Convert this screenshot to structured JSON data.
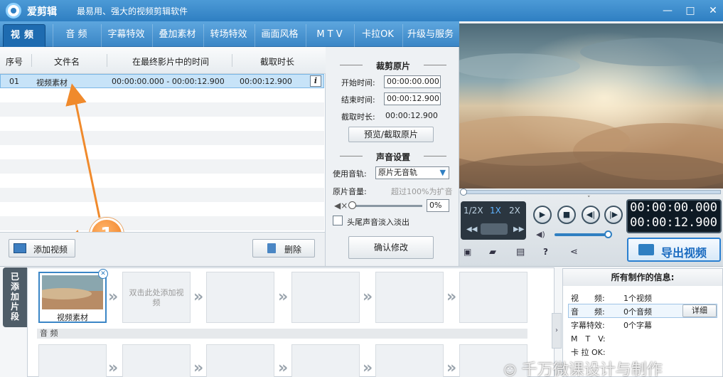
{
  "app": {
    "name": "爱剪辑",
    "subtitle": "最易用、强大的视频剪辑软件"
  },
  "window_controls": {
    "minimize": "—",
    "maximize": "□",
    "close": "✕"
  },
  "nav": {
    "tabs": [
      {
        "label": "视频"
      },
      {
        "label": "音 频"
      },
      {
        "label": "字幕特效"
      },
      {
        "label": "叠加素材"
      },
      {
        "label": "转场特效"
      },
      {
        "label": "画面风格"
      },
      {
        "label": "M T V"
      },
      {
        "label": "卡拉OK"
      },
      {
        "label": "升级与服务"
      }
    ]
  },
  "table": {
    "headers": [
      "序号",
      "文件名",
      "在最终影片中的时间",
      "截取时长"
    ],
    "rows": [
      {
        "index": "01",
        "name": "视频素材",
        "range": "00:00:00.000 - 00:00:12.900",
        "duration": "00:00:12.900",
        "info": "i"
      }
    ]
  },
  "left_buttons": {
    "add": "添加视频",
    "delete": "删除"
  },
  "annotation": {
    "number": "1"
  },
  "trim": {
    "heading": "裁剪原片",
    "start_label": "开始时间:",
    "start_value": "00:00:00.000",
    "end_label": "结束时间:",
    "end_value": "00:00:12.900",
    "dur_label": "截取时长:",
    "dur_value": "00:00:12.900",
    "preview_btn": "预览/截取原片"
  },
  "audio": {
    "heading": "声音设置",
    "track_label": "使用音轨:",
    "track_value": "原片无音轨",
    "volume_label": "原片音量:",
    "volume_hint": "超过100%为扩音",
    "volume_value": "0%",
    "fade_label": "头尾声音淡入淡出",
    "confirm_btn": "确认修改"
  },
  "player": {
    "speeds": [
      "1/2X",
      "1X",
      "2X"
    ],
    "time_current": "00:00:00.000",
    "time_total": "00:00:12.900",
    "export_btn": "导出视频",
    "progress": 0,
    "volume": 1.0
  },
  "timeline": {
    "side_tab": "已添加片段",
    "clip1_label": "视频素材",
    "placeholder": "双击此处添加视频",
    "audio_label": "音 频"
  },
  "info_panel": {
    "title": "所有制作的信息:",
    "rows": [
      {
        "key": "视　　频:",
        "value": "1个视频"
      },
      {
        "key": "音　　频:",
        "value": "0个音频"
      },
      {
        "key": "字幕特效:",
        "value": "0个字幕"
      },
      {
        "key": "M　T　V:",
        "value": ""
      },
      {
        "key": "卡 拉 OK:",
        "value": ""
      }
    ],
    "detail_btn": "详细"
  },
  "watermark": "千万微课设计与制作",
  "colors": {
    "accent": "#2f7fc2",
    "selected_row": "#c7e3f8",
    "annotation": "#f08a2c",
    "export": "#1a6bc0"
  }
}
